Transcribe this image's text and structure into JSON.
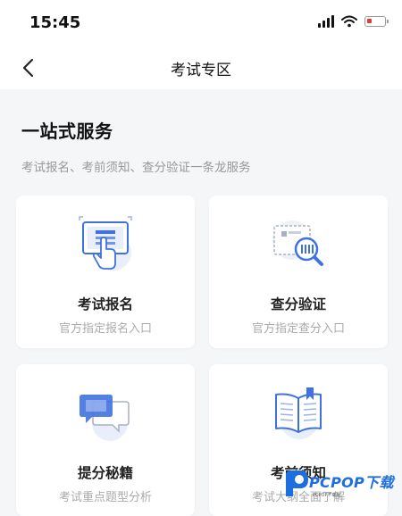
{
  "status_bar": {
    "time": "15:45"
  },
  "nav": {
    "title": "考试专区"
  },
  "intro": {
    "title": "一站式服务",
    "subtitle": "考试报名、考前须知、查分验证一条龙服务"
  },
  "cards": [
    {
      "title": "考试报名",
      "subtitle": "官方指定报名入口",
      "icon": "registration-screen-hand-icon"
    },
    {
      "title": "查分验证",
      "subtitle": "官方指定查分入口",
      "icon": "score-check-magnifier-icon"
    },
    {
      "title": "提分秘籍",
      "subtitle": "考试重点题型分析",
      "icon": "chat-bubbles-icon"
    },
    {
      "title": "考前须知",
      "subtitle": "考试大纲全面了解",
      "icon": "open-book-icon"
    }
  ],
  "watermark": {
    "brand": "PCPOP下载",
    "small": "PCPOP下载站"
  },
  "colors": {
    "accent": "#3f72e0",
    "light_blue": "#e9eefb",
    "battery_low": "#e53935"
  }
}
